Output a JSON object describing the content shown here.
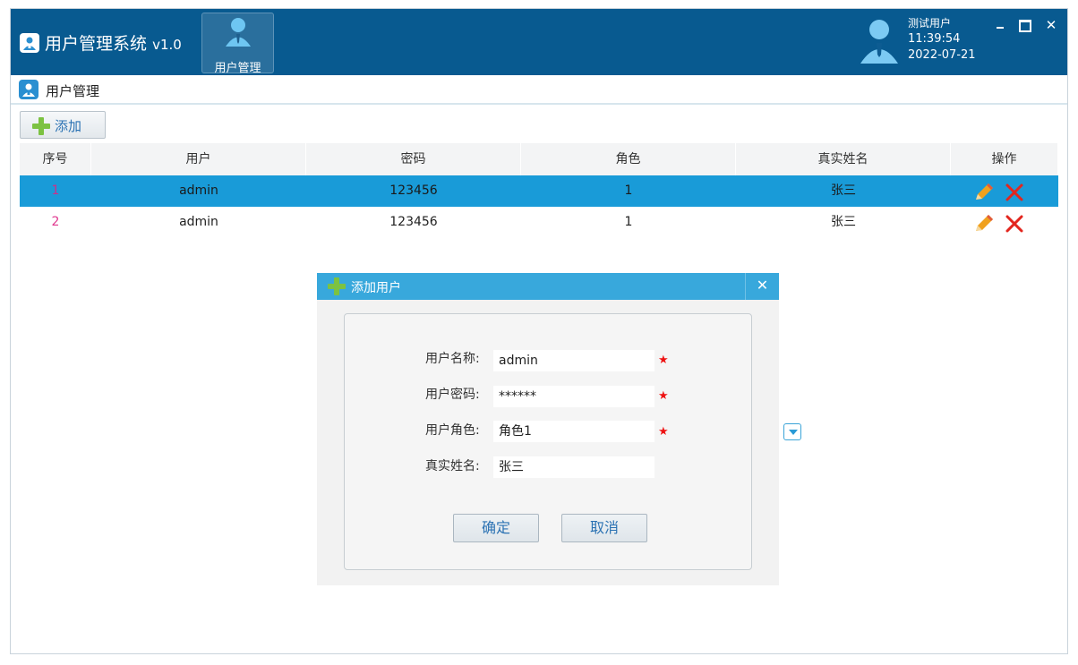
{
  "app": {
    "title": "用户管理系统",
    "version": "v1.0",
    "nav_tab_label": "用户管理",
    "user_name": "测试用户",
    "time": "11:39:54",
    "date": "2022-07-21",
    "close_glyph": "✕"
  },
  "breadcrumb": {
    "label": "用户管理"
  },
  "toolbar": {
    "add_label": "添加"
  },
  "table": {
    "headers": [
      "序号",
      "用户",
      "密码",
      "角色",
      "真实姓名",
      "操作"
    ],
    "rows": [
      {
        "index": "1",
        "user": "admin",
        "password": "123456",
        "role": "1",
        "real_name": "张三",
        "selected": true
      },
      {
        "index": "2",
        "user": "admin",
        "password": "123456",
        "role": "1",
        "real_name": "张三",
        "selected": false
      }
    ]
  },
  "dialog": {
    "title": "添加用户",
    "close_glyph": "✕",
    "fields": {
      "username_label": "用户名称:",
      "username_value": "admin",
      "password_label": "用户密码:",
      "password_value": "******",
      "role_label": "用户角色:",
      "role_value": "角色1",
      "realname_label": "真实姓名:",
      "realname_value": "张三"
    },
    "required_mark": "★",
    "confirm_label": "确定",
    "cancel_label": "取消"
  },
  "colors": {
    "titlebar": "#085a90",
    "selected_row": "#199bd8",
    "dialog_header": "#38a8dc",
    "accent_text": "#2b72b3"
  },
  "icons": [
    "user-logo-icon",
    "user-manage-icon",
    "user-avatar-icon",
    "minimize-icon",
    "maximize-icon",
    "close-icon",
    "plus-icon",
    "edit-pencil-icon",
    "delete-x-icon",
    "dropdown-arrow-icon",
    "required-star-icon"
  ]
}
